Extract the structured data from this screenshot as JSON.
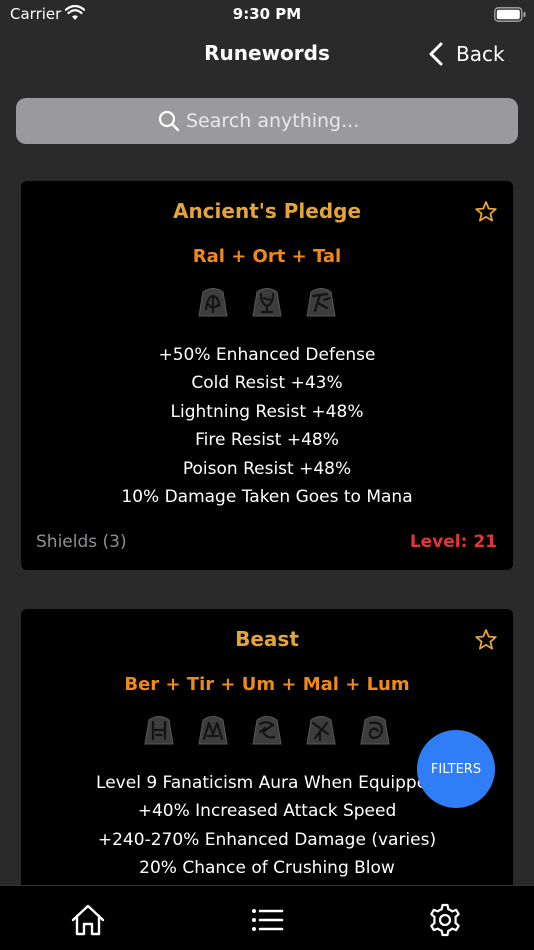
{
  "status": {
    "carrier": "Carrier",
    "time": "9:30 PM"
  },
  "nav": {
    "title": "Runewords",
    "back_label": "Back"
  },
  "search": {
    "placeholder": "Search anything..."
  },
  "runewords": [
    {
      "name": "Ancient's Pledge",
      "runes": "Ral + Ort + Tal",
      "rune_icons": [
        "ral-rune-icon",
        "ort-rune-icon",
        "tal-rune-icon"
      ],
      "stats": [
        "+50% Enhanced Defense",
        "Cold Resist +43%",
        "Lightning Resist +48%",
        "Fire Resist +48%",
        "Poison Resist +48%",
        "10% Damage Taken Goes to Mana"
      ],
      "category": "Shields (3)",
      "level": "Level: 21"
    },
    {
      "name": "Beast",
      "runes": "Ber + Tir + Um + Mal + Lum",
      "rune_icons": [
        "ber-rune-icon",
        "tir-rune-icon",
        "um-rune-icon",
        "mal-rune-icon",
        "lum-rune-icon"
      ],
      "stats": [
        "Level 9 Fanaticism Aura When Equipped",
        "+40% Increased Attack Speed",
        "+240-270% Enhanced Damage (varies)",
        "20% Chance of Crushing Blow"
      ]
    }
  ],
  "filters_label": "FILTERS",
  "tabs": [
    "home-icon",
    "list-icon",
    "gear-icon"
  ],
  "colors": {
    "accent_gold": "#e3a43a",
    "rune_orange": "#f0891a",
    "level_red": "#e0353a",
    "filters_blue": "#2f7ef7"
  }
}
